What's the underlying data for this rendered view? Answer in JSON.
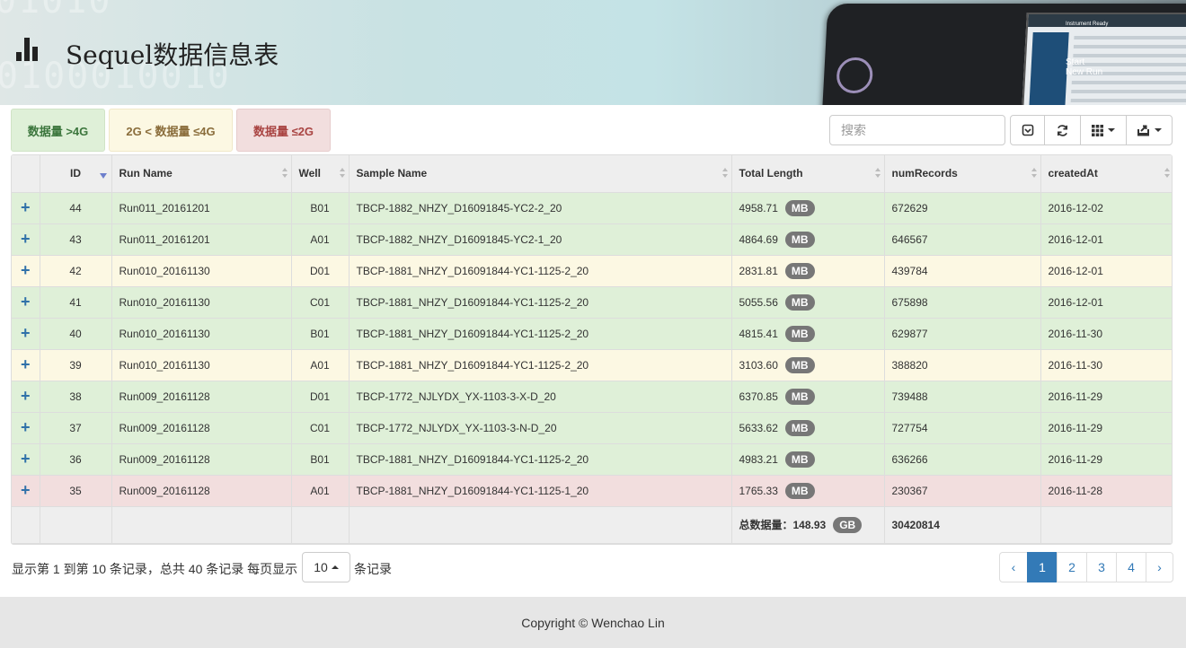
{
  "header": {
    "title": "Sequel数据信息表",
    "instrument_label": "Instrument  Ready",
    "start_label": "Start",
    "new_run_label": "New Run"
  },
  "legend": {
    "high": "数据量 >4G",
    "mid": "2G < 数据量 ≤4G",
    "low": "数据量 ≤2G"
  },
  "toolbar": {
    "search_placeholder": "搜索"
  },
  "table": {
    "columns": [
      "ID",
      "Run Name",
      "Well",
      "Sample Name",
      "Total Length",
      "numRecords",
      "createdAt"
    ],
    "rows": [
      {
        "id": "44",
        "run": "Run011_20161201",
        "well": "B01",
        "sample": "TBCP-1882_NHZY_D16091845-YC2-2_20",
        "length": "4958.71",
        "unit": "MB",
        "records": "672629",
        "created": "2016-12-02",
        "status": "success"
      },
      {
        "id": "43",
        "run": "Run011_20161201",
        "well": "A01",
        "sample": "TBCP-1882_NHZY_D16091845-YC2-1_20",
        "length": "4864.69",
        "unit": "MB",
        "records": "646567",
        "created": "2016-12-01",
        "status": "success"
      },
      {
        "id": "42",
        "run": "Run010_20161130",
        "well": "D01",
        "sample": "TBCP-1881_NHZY_D16091844-YC1-1125-2_20",
        "length": "2831.81",
        "unit": "MB",
        "records": "439784",
        "created": "2016-12-01",
        "status": "warning"
      },
      {
        "id": "41",
        "run": "Run010_20161130",
        "well": "C01",
        "sample": "TBCP-1881_NHZY_D16091844-YC1-1125-2_20",
        "length": "5055.56",
        "unit": "MB",
        "records": "675898",
        "created": "2016-12-01",
        "status": "success"
      },
      {
        "id": "40",
        "run": "Run010_20161130",
        "well": "B01",
        "sample": "TBCP-1881_NHZY_D16091844-YC1-1125-2_20",
        "length": "4815.41",
        "unit": "MB",
        "records": "629877",
        "created": "2016-11-30",
        "status": "success"
      },
      {
        "id": "39",
        "run": "Run010_20161130",
        "well": "A01",
        "sample": "TBCP-1881_NHZY_D16091844-YC1-1125-2_20",
        "length": "3103.60",
        "unit": "MB",
        "records": "388820",
        "created": "2016-11-30",
        "status": "warning"
      },
      {
        "id": "38",
        "run": "Run009_20161128",
        "well": "D01",
        "sample": "TBCP-1772_NJLYDX_YX-1103-3-X-D_20",
        "length": "6370.85",
        "unit": "MB",
        "records": "739488",
        "created": "2016-11-29",
        "status": "success"
      },
      {
        "id": "37",
        "run": "Run009_20161128",
        "well": "C01",
        "sample": "TBCP-1772_NJLYDX_YX-1103-3-N-D_20",
        "length": "5633.62",
        "unit": "MB",
        "records": "727754",
        "created": "2016-11-29",
        "status": "success"
      },
      {
        "id": "36",
        "run": "Run009_20161128",
        "well": "B01",
        "sample": "TBCP-1881_NHZY_D16091844-YC1-1125-2_20",
        "length": "4983.21",
        "unit": "MB",
        "records": "636266",
        "created": "2016-11-29",
        "status": "success"
      },
      {
        "id": "35",
        "run": "Run009_20161128",
        "well": "A01",
        "sample": "TBCP-1881_NHZY_D16091844-YC1-1125-1_20",
        "length": "1765.33",
        "unit": "MB",
        "records": "230367",
        "created": "2016-11-28",
        "status": "danger"
      }
    ],
    "footer": {
      "total_label": "总数据量：148.93",
      "total_unit": "GB",
      "total_records": "30420814"
    }
  },
  "pagination": {
    "info": "显示第 1 到第 10 条记录，总共 40 条记录 每页显示",
    "page_size": "10",
    "after": "条记录",
    "prev": "‹",
    "pages": [
      "1",
      "2",
      "3",
      "4"
    ],
    "next": "›",
    "active_page": "1"
  },
  "footer": {
    "copyright": "Copyright © Wenchao Lin"
  }
}
